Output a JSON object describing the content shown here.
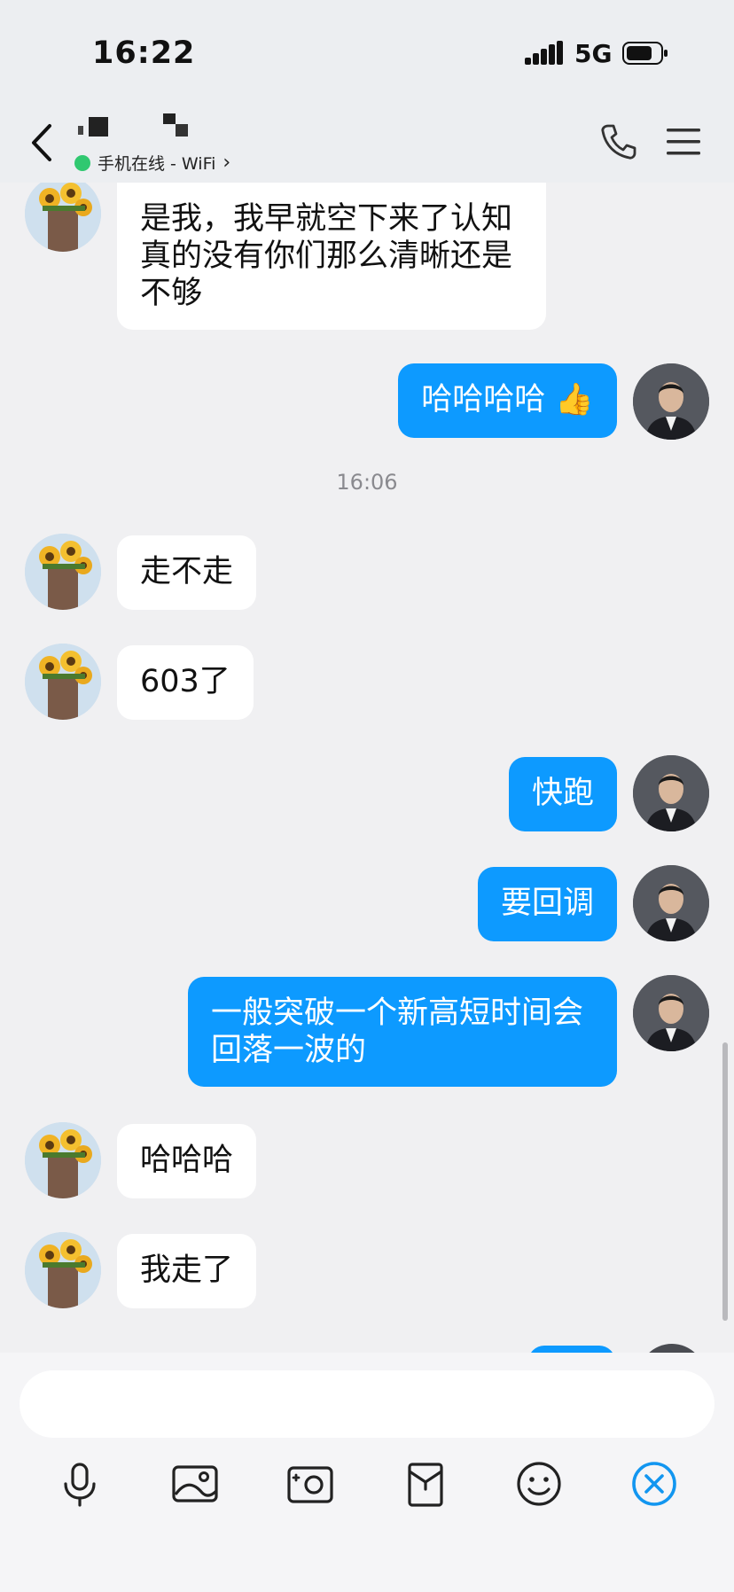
{
  "status_bar": {
    "time": "16:22",
    "network": "5G"
  },
  "header": {
    "presence_text": "手机在线 - WiFi",
    "presence_chevron": "›"
  },
  "messages": [
    {
      "side": "in",
      "text": "是我，我早就空下来了认知真的没有你们那么清晰还是不够"
    },
    {
      "side": "out",
      "text": "哈哈哈哈 👍"
    },
    {
      "type": "time",
      "text": "16:06"
    },
    {
      "side": "in",
      "text": "走不走"
    },
    {
      "side": "in",
      "text": "603了"
    },
    {
      "side": "out",
      "text": "快跑"
    },
    {
      "side": "out",
      "text": "要回调"
    },
    {
      "side": "out",
      "text": "一般突破一个新高短时间会回落一波的"
    },
    {
      "side": "in",
      "text": "哈哈哈"
    },
    {
      "side": "in",
      "text": "我走了"
    }
  ],
  "input": {
    "placeholder": ""
  },
  "toolbar": [
    {
      "icon": "microphone-icon"
    },
    {
      "icon": "image-icon"
    },
    {
      "icon": "camera-icon"
    },
    {
      "icon": "red-packet-icon"
    },
    {
      "icon": "emoji-icon"
    },
    {
      "icon": "close-circle-icon"
    }
  ],
  "colors": {
    "outgoing_bubble": "#0d9aff",
    "incoming_bubble": "#ffffff",
    "online_dot": "#30c870",
    "accent": "#1296f0"
  }
}
